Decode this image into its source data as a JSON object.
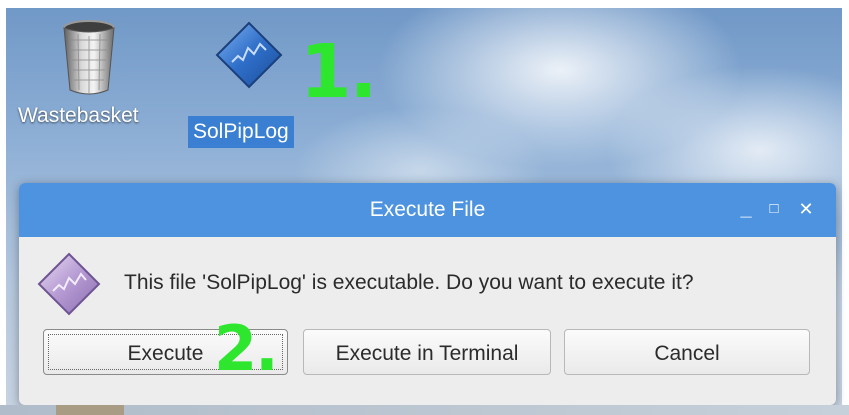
{
  "desktop": {
    "icons": [
      {
        "label": "Wastebasket",
        "icon": "trash-bin-icon"
      },
      {
        "label": "SolPipLog",
        "icon": "executable-diamond-icon",
        "selected": true
      }
    ]
  },
  "annotations": {
    "step1": "1.",
    "step2": "2."
  },
  "dialog": {
    "title": "Execute File",
    "window_controls": {
      "minimize": "_",
      "maximize": "□",
      "close": "✕"
    },
    "icon": "executable-diamond-icon",
    "message": "This file 'SolPipLog' is executable. Do you want to execute it?",
    "buttons": {
      "execute": "Execute",
      "execute_terminal": "Execute in Terminal",
      "cancel": "Cancel"
    }
  },
  "colors": {
    "titlebar": "#4d93e0",
    "selection": "#3a7fd1",
    "annotation": "#2ee62e"
  }
}
